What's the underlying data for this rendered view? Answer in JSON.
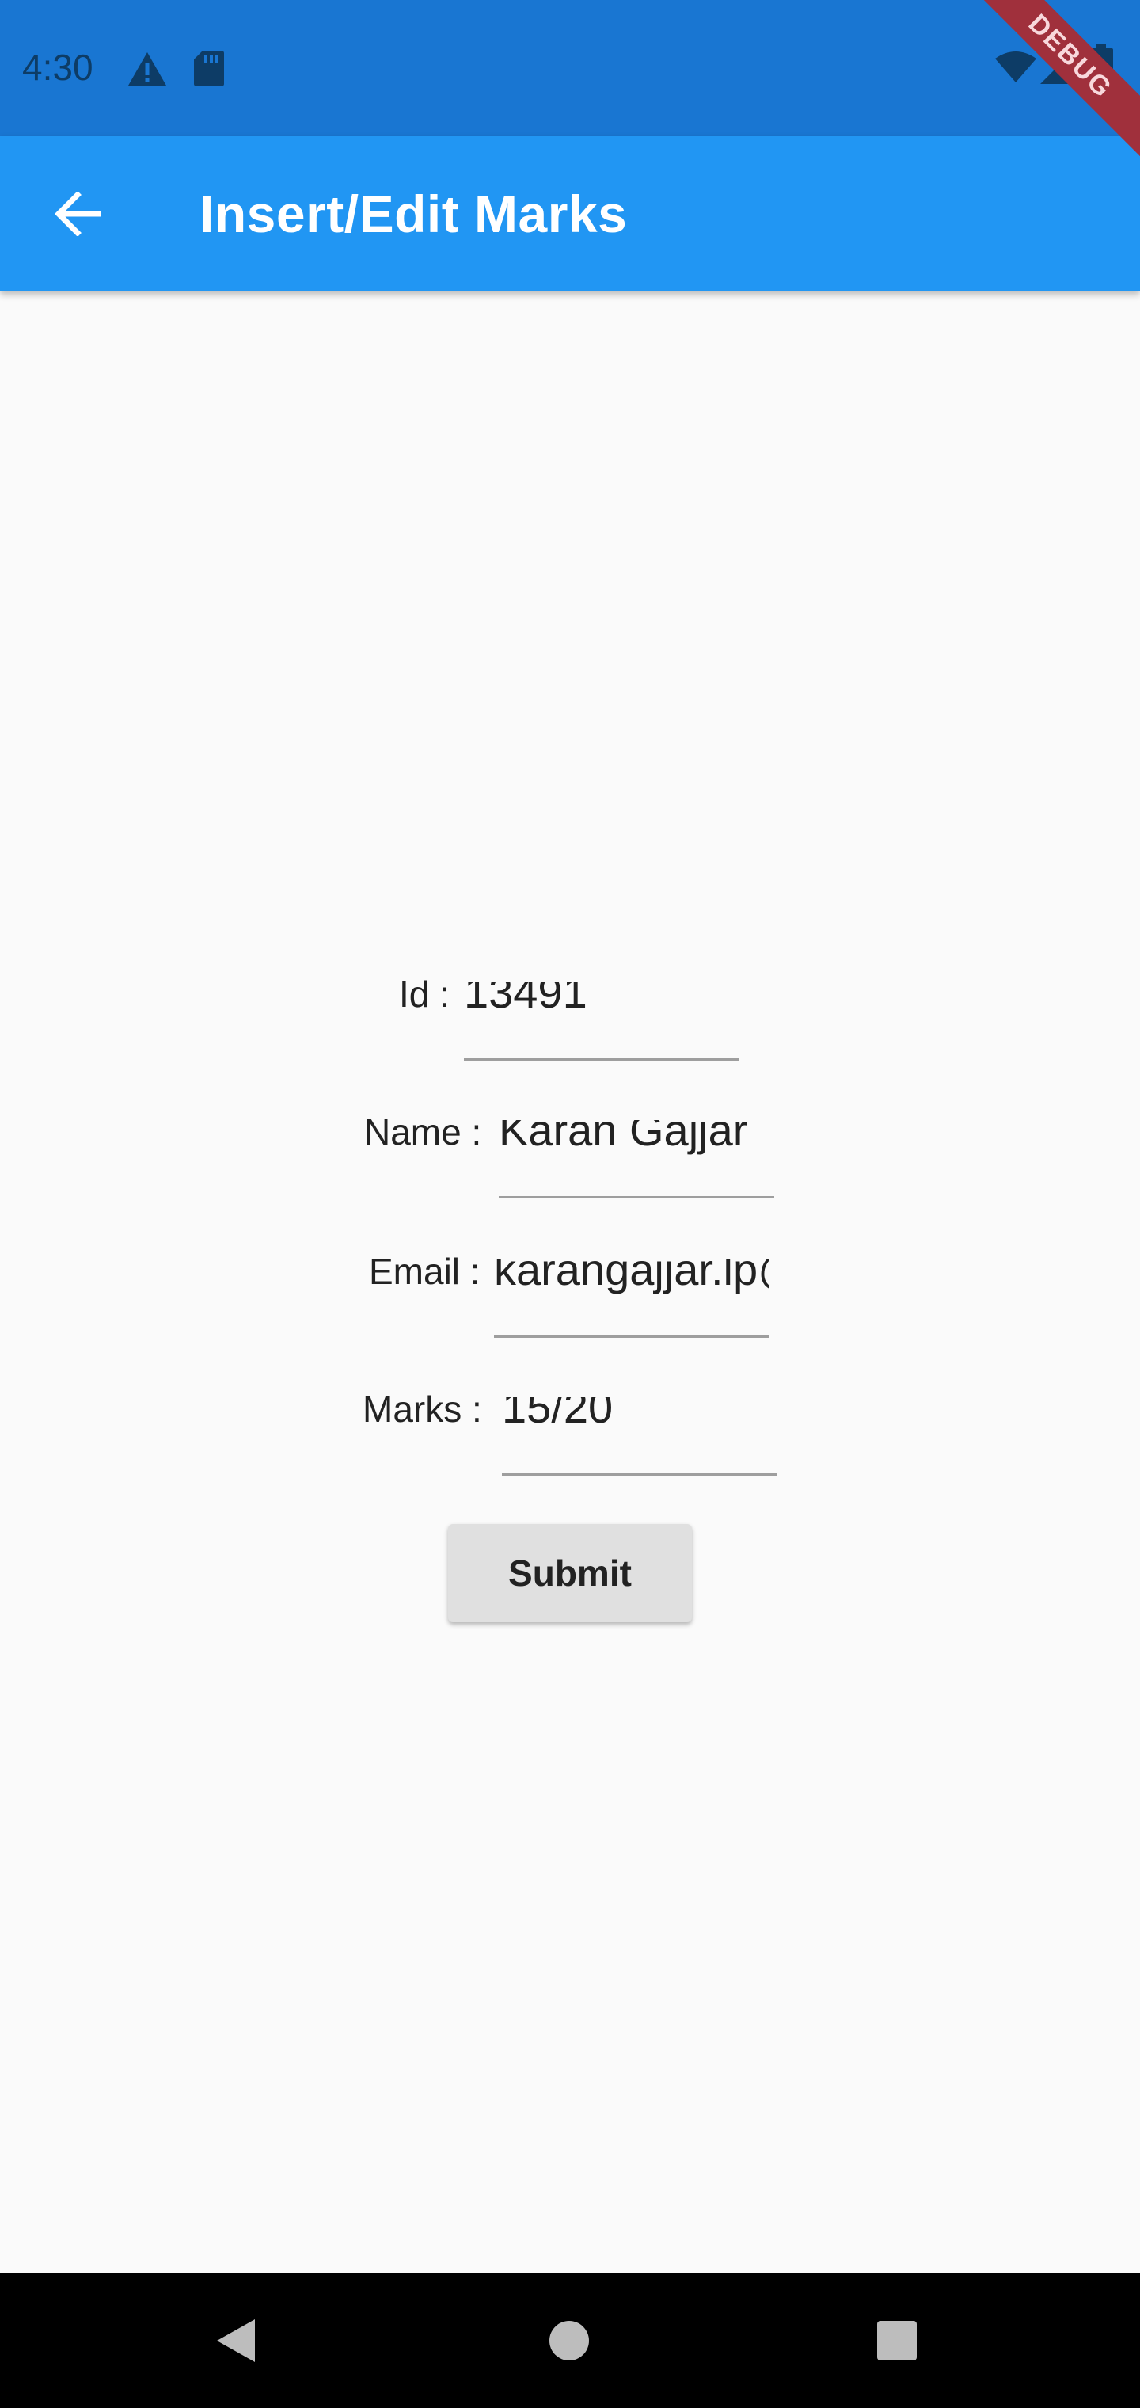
{
  "status_bar": {
    "time": "4:30",
    "icons": [
      "warning-icon",
      "sd-card-icon",
      "wifi-icon",
      "signal-icon",
      "battery-icon"
    ]
  },
  "app_bar": {
    "title": "Insert/Edit Marks",
    "back_icon": "arrow-left-icon",
    "color": "#2196f3"
  },
  "debug_banner": "DEBUG",
  "form": {
    "id": {
      "label": "Id :",
      "value": "13491"
    },
    "name": {
      "label": "Name :",
      "value": "Karan Gajjar"
    },
    "email": {
      "label": "Email :",
      "value": "karangajjar.lp@"
    },
    "marks": {
      "label": "Marks :",
      "value": "15/20"
    },
    "submit_label": "Submit"
  },
  "nav_bar": {
    "icons": [
      "back-triangle-icon",
      "home-circle-icon",
      "recents-square-icon"
    ]
  }
}
